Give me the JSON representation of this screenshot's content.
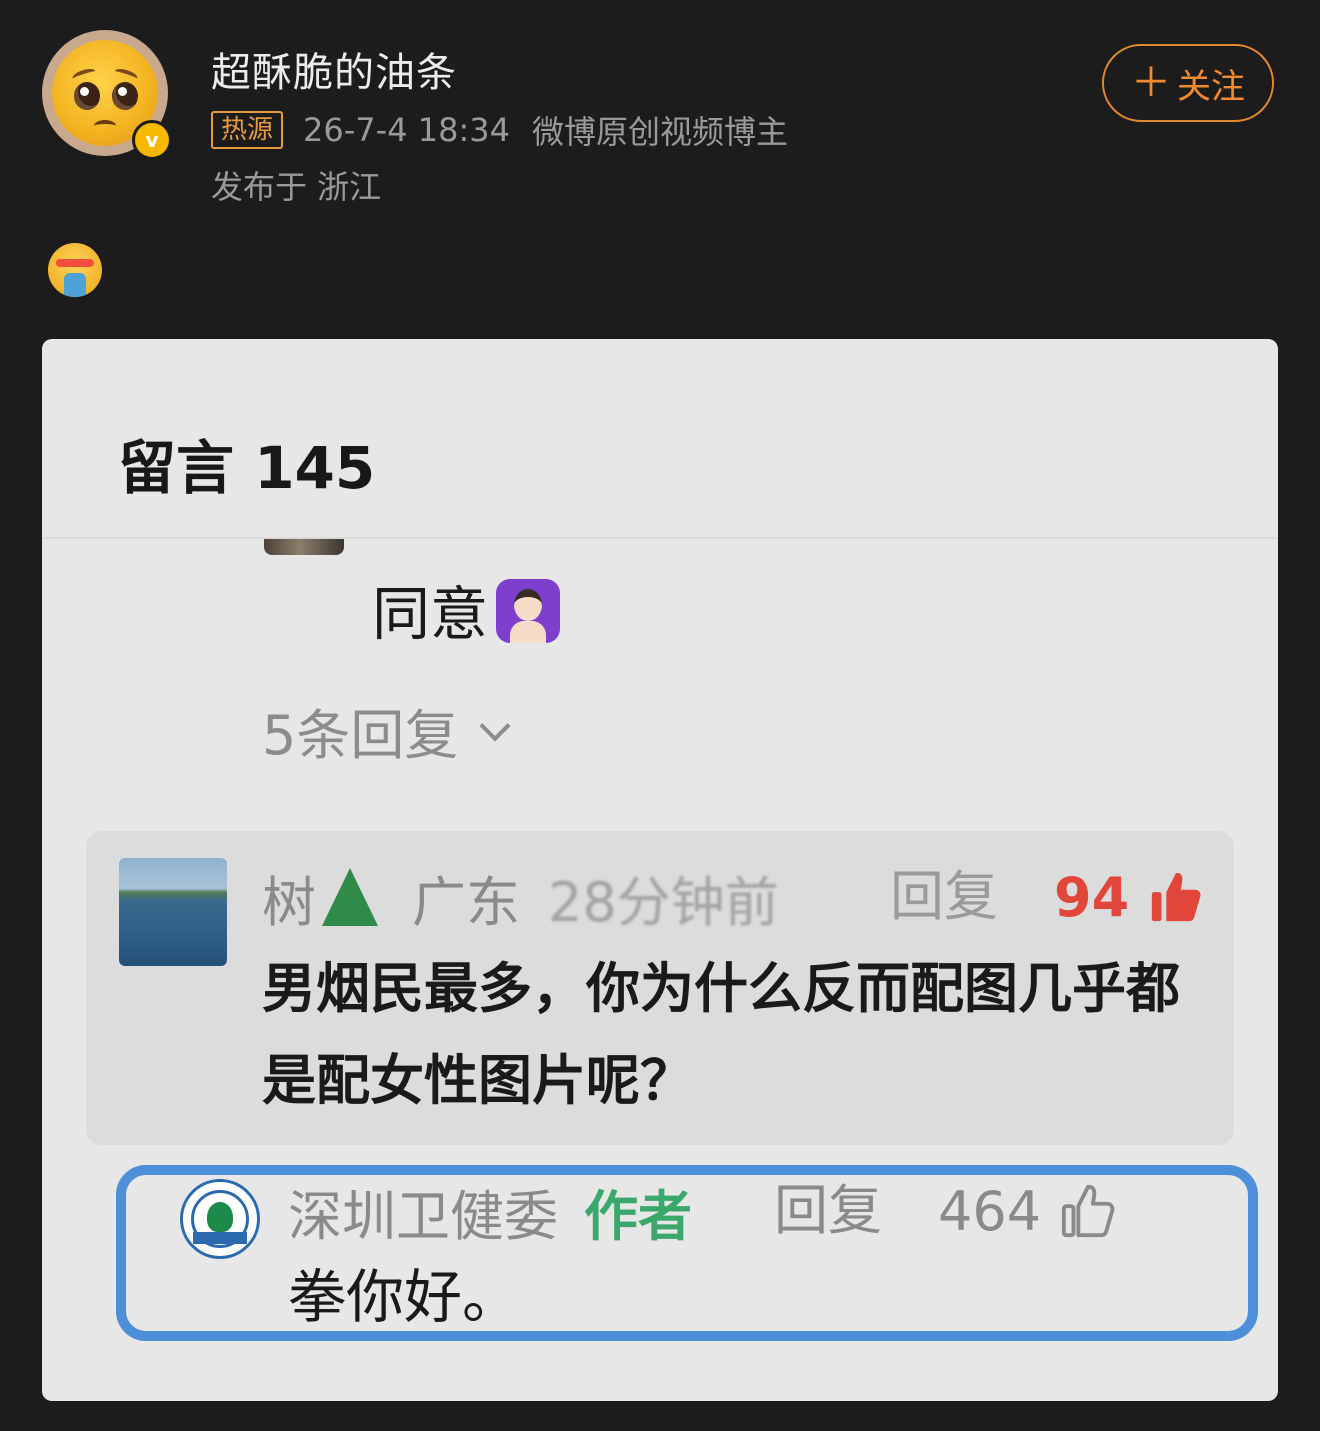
{
  "post": {
    "author_name": "超酥脆的油条",
    "hot_tag": "热源",
    "time": "26-7-4 18:34",
    "author_desc": "微博原创视频博主",
    "location": "发布于 浙江",
    "follow_label": "关注",
    "follow_plus": "＋",
    "verified_mark": "v",
    "emoji": "vomiting-face-emoji"
  },
  "screenshot": {
    "comments_title": "留言 145",
    "comment": {
      "text": "同意",
      "emoji": "person-gesturing-ok-emoji"
    },
    "replies_toggle": "5条回复",
    "reply": {
      "user": "树",
      "user_emoji": "evergreen-tree",
      "location": "广东",
      "time": "28分钟前",
      "reply_label": "回复",
      "like_count": "94",
      "text": "男烟民最多，你为什么反而配图几乎都是配女性图片呢？"
    },
    "author_reply": {
      "user": "深圳卫健委",
      "author_tag": "作者",
      "reply_label": "回复",
      "like_count": "464",
      "text": "拳你好。"
    }
  },
  "colors": {
    "background": "#1c1c1c",
    "accent_orange": "#f08b30",
    "like_red": "#e0473a",
    "author_green": "#3aa86a",
    "highlight_blue": "#4d8fd8"
  }
}
